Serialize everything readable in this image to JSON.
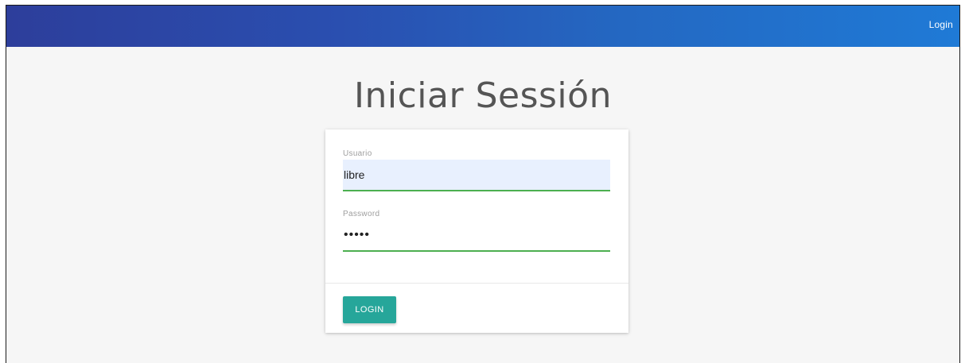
{
  "navbar": {
    "login_link": "Login"
  },
  "main": {
    "title": "Iniciar Sessión"
  },
  "form": {
    "usuario_label": "Usuario",
    "usuario_value": "libre",
    "password_label": "Password",
    "password_value": "•••••",
    "submit_label": "LOGIN"
  },
  "colors": {
    "navbar_start": "#2d3e9b",
    "navbar_end": "#1f7ad6",
    "button": "#26a69a",
    "input_underline": "#4caf50",
    "autofill_background": "#e8f0fe"
  }
}
